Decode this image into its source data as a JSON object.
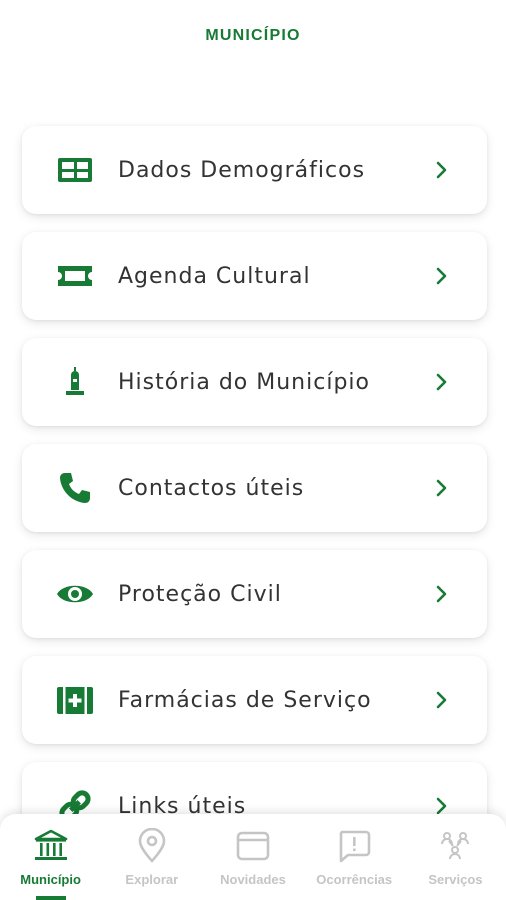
{
  "header": {
    "title": "MUNICÍPIO"
  },
  "menu": {
    "items": [
      {
        "label": "Dados Demográficos",
        "icon": "table-icon"
      },
      {
        "label": "Agenda Cultural",
        "icon": "ticket-icon"
      },
      {
        "label": "História do Município",
        "icon": "monument-icon"
      },
      {
        "label": "Contactos úteis",
        "icon": "phone-icon"
      },
      {
        "label": "Proteção Civil",
        "icon": "eye-icon"
      },
      {
        "label": "Farmácias de Serviço",
        "icon": "medical-kit-icon"
      },
      {
        "label": "Links úteis",
        "icon": "link-icon"
      }
    ]
  },
  "bottom_nav": {
    "items": [
      {
        "label": "Município",
        "icon": "bank-icon",
        "active": true
      },
      {
        "label": "Explorar",
        "icon": "map-pin-icon",
        "active": false
      },
      {
        "label": "Novidades",
        "icon": "card-icon",
        "active": false
      },
      {
        "label": "Ocorrências",
        "icon": "alert-message-icon",
        "active": false
      },
      {
        "label": "Serviços",
        "icon": "people-network-icon",
        "active": false
      }
    ]
  },
  "colors": {
    "brand_green": "#177a35",
    "inactive_gray": "#c5c5c5",
    "text_dark": "#333333"
  }
}
